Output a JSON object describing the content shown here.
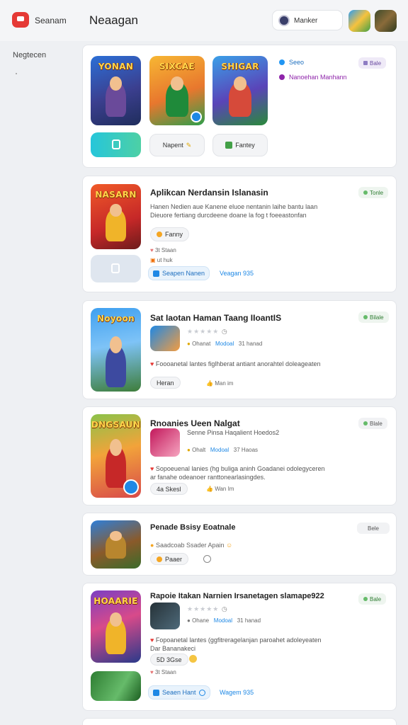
{
  "topbar": {
    "brand": "Seanam",
    "title": "Neaagan",
    "user_name": "Manker"
  },
  "sidebar": {
    "label": "Negtecen"
  },
  "card1": {
    "thumb_titles": [
      "YONAN",
      "SIXCAE",
      "SHIGAR"
    ],
    "btn_mid": "Napent",
    "btn_right": "Fantey",
    "side_item1": "Seeo",
    "side_item2": "Nanoehan Manhann",
    "badge": "Bale"
  },
  "card2": {
    "thumb_title": "NASARN",
    "title": "Aplikcan Nerdansin Islanasin",
    "desc1": "Hanen Nedien aue Kanene eluoe nentanin laihe bantu laan",
    "desc2": "Dieuore fertiang durcdeene doane la fog t foeeastonfan",
    "pill": "Fanny",
    "meta1": "3t Staan",
    "meta2": "ut huk",
    "btn": "Seapen Nanen",
    "link": "Veagan 935",
    "badge": "Tonle"
  },
  "card3": {
    "thumb_title": "Noyoon",
    "title": "Sat Iaotan Haman Taang IIoantIS",
    "meta_author": "Ohanat",
    "meta_link": "Modoal",
    "meta_date": "31 hanad",
    "desc": "Foooanetal lantes figlhberat antiant anorahtel doleageaten",
    "pill": "Heran",
    "like": "Man im",
    "badge": "Bilale"
  },
  "card4": {
    "thumb_title": "DNGSAUN",
    "title": "Rnoanies Ueen Nalgat",
    "subtitle": "Senne Pinsa Haqalient Hoedos2",
    "meta_author": "Ohalt",
    "meta_link": "Modoal",
    "meta_date": "37 Haoas",
    "desc1": "Sopoeuenal lanies (hg buliga aninh Goadanei odolegyceren",
    "desc2": "ar fanahe odeanoer ranttonearlasingdes.",
    "pill": "4a Skesl",
    "like": "Wan Im",
    "badge": "Blale"
  },
  "card5": {
    "title": "Penade Bsisy Eoatnale",
    "line": "Saadcoab Ssader Apain",
    "pill": "Paaer",
    "badge": "Bele"
  },
  "card6": {
    "thumb_title": "HOAARIE",
    "title": "Rapoie Itakan Narnien Irsanetagen slamape922",
    "meta_author": "Ohane",
    "meta_link": "Modoal",
    "meta_date": "31 hanad",
    "desc1": "Fopoanetal lantes (ggfitreragelanjan paroahet adoleyeaten",
    "desc2": "Dar Bananakeci",
    "pill": "5D 3Gse",
    "meta1": "3t Staan",
    "btn": "Seaen Hant",
    "link": "Wagem 935",
    "badge": "Bale"
  }
}
